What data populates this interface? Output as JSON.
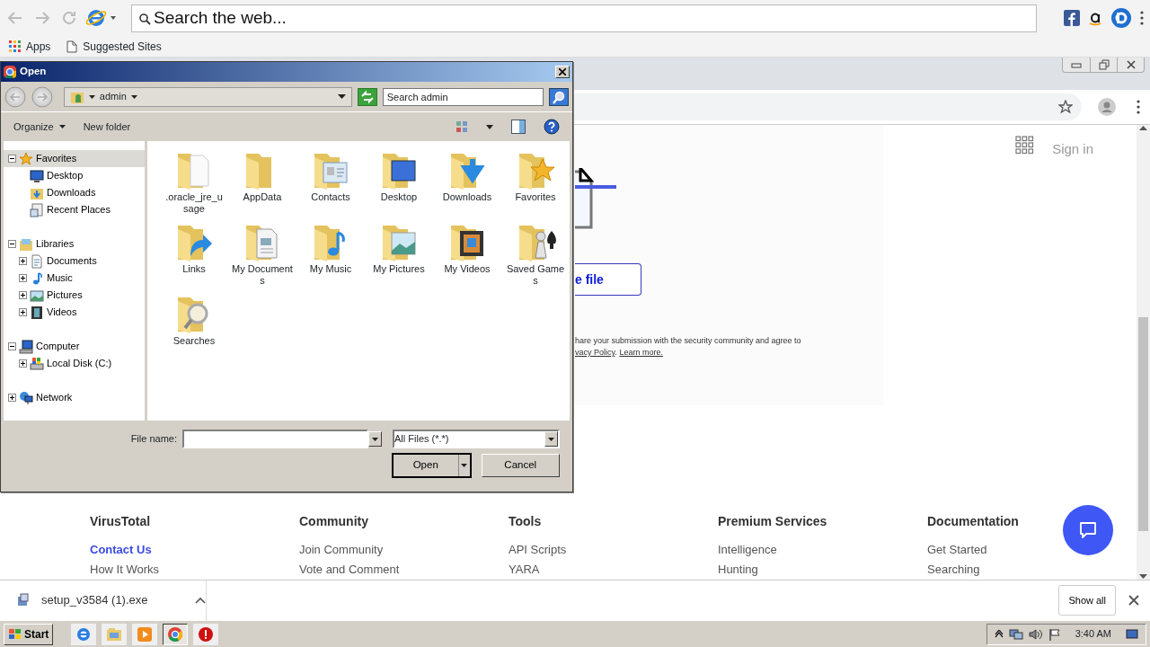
{
  "toolbar": {
    "search_placeholder": "Search the web..."
  },
  "bookmarks": [
    "Apps",
    "Suggested Sites"
  ],
  "page": {
    "upload_button": "e file",
    "notice": "hare your submission with the security community and agree to",
    "policy_link": "vacy Policy",
    "separator": ".",
    "learn_more": "Learn more.",
    "sign_in": "Sign in"
  },
  "footer": [
    {
      "heading": "VirusTotal",
      "links": [
        {
          "label": "Contact Us",
          "highlighted": true
        },
        {
          "label": "How It Works",
          "highlighted": false
        }
      ]
    },
    {
      "heading": "Community",
      "links": [
        {
          "label": "Join Community",
          "highlighted": false
        },
        {
          "label": "Vote and Comment",
          "highlighted": false
        }
      ]
    },
    {
      "heading": "Tools",
      "links": [
        {
          "label": "API Scripts",
          "highlighted": false
        },
        {
          "label": "YARA",
          "highlighted": false
        }
      ]
    },
    {
      "heading": "Premium Services",
      "links": [
        {
          "label": "Intelligence",
          "highlighted": false
        },
        {
          "label": "Hunting",
          "highlighted": false
        }
      ]
    },
    {
      "heading": "Documentation",
      "links": [
        {
          "label": "Get Started",
          "highlighted": false
        },
        {
          "label": "Searching",
          "highlighted": false
        }
      ]
    }
  ],
  "download": {
    "file": "setup_v3584 (1).exe",
    "show_all": "Show all"
  },
  "dialog": {
    "title": "Open",
    "breadcrumb": "admin",
    "search_placeholder": "Search admin",
    "commands": [
      "Organize",
      "New folder"
    ],
    "tree": [
      {
        "label": "Favorites",
        "kind": "star",
        "expanded": true,
        "selected": true,
        "children": [
          {
            "label": "Desktop",
            "kind": "desktop"
          },
          {
            "label": "Downloads",
            "kind": "downloads"
          },
          {
            "label": "Recent Places",
            "kind": "recent"
          }
        ]
      },
      {
        "label": "Libraries",
        "kind": "library",
        "expanded": true,
        "selected": false,
        "children": [
          {
            "label": "Documents",
            "kind": "document",
            "expanded": false
          },
          {
            "label": "Music",
            "kind": "music",
            "expanded": false
          },
          {
            "label": "Pictures",
            "kind": "pictures",
            "expanded": false
          },
          {
            "label": "Videos",
            "kind": "video",
            "expanded": false
          }
        ]
      },
      {
        "label": "Computer",
        "kind": "computer",
        "expanded": true,
        "selected": false,
        "children": [
          {
            "label": "Local Disk (C:)",
            "kind": "disk",
            "expanded": false
          }
        ]
      },
      {
        "label": "Network",
        "kind": "network",
        "expanded": false,
        "selected": false
      }
    ],
    "items": [
      {
        "label": ".oracle_jre_usage",
        "kind": "paper"
      },
      {
        "label": "AppData",
        "kind": "plain"
      },
      {
        "label": "Contacts",
        "kind": "contacts"
      },
      {
        "label": "Desktop",
        "kind": "desktop"
      },
      {
        "label": "Downloads",
        "kind": "downloads"
      },
      {
        "label": "Favorites",
        "kind": "star"
      },
      {
        "label": "Links",
        "kind": "link"
      },
      {
        "label": "My Documents",
        "kind": "document"
      },
      {
        "label": "My Music",
        "kind": "music"
      },
      {
        "label": "My Pictures",
        "kind": "pictures"
      },
      {
        "label": "My Videos",
        "kind": "video"
      },
      {
        "label": "Saved Games",
        "kind": "games"
      },
      {
        "label": "Searches",
        "kind": "search"
      }
    ],
    "file_name_label": "File name:",
    "file_type": "All Files (*.*)",
    "open": "Open",
    "cancel": "Cancel"
  },
  "taskbar": {
    "start": "Start",
    "apps": [
      {
        "kind": "ie",
        "selected": false
      },
      {
        "kind": "explorer",
        "selected": false
      },
      {
        "kind": "media",
        "selected": false
      },
      {
        "kind": "chrome",
        "selected": true
      },
      {
        "kind": "stop",
        "selected": false
      }
    ],
    "clock": "3:40 AM"
  }
}
